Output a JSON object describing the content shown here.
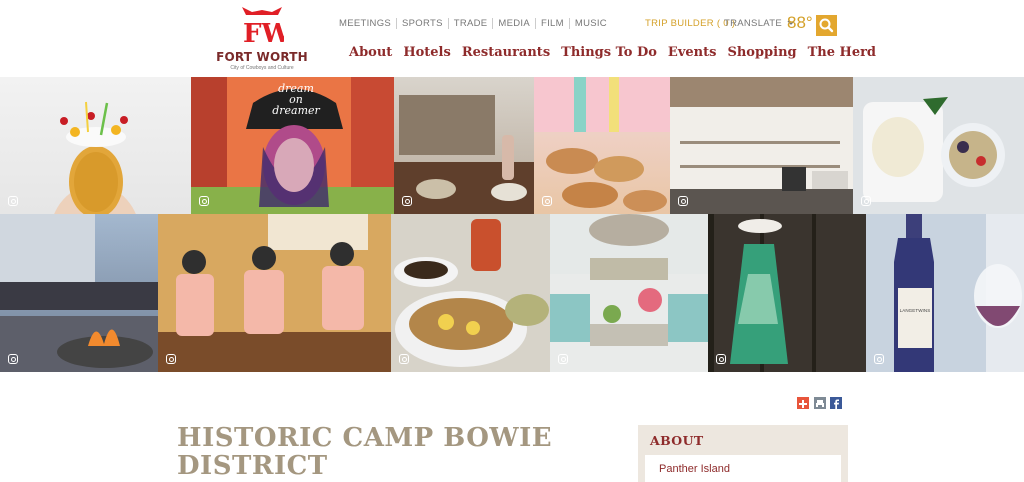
{
  "brand": {
    "name": "FORT WORTH",
    "tagline": "City of Cowboys and Culture",
    "red": "#e01f26",
    "maroon": "#8e2b2b",
    "gold": "#e3a72f"
  },
  "topnav": {
    "items": [
      "MEETINGS",
      "SPORTS",
      "TRADE",
      "MEDIA",
      "FILM",
      "MUSIC"
    ]
  },
  "utility": {
    "trip_builder": "TRIP BUILDER ( 0 )",
    "translate": "TRANSLATE",
    "temperature": "88°",
    "search_icon": "magnifier-icon"
  },
  "mainnav": {
    "items": [
      "About",
      "Hotels",
      "Restaurants",
      "Things To Do",
      "Events",
      "Shopping",
      "The Herd"
    ]
  },
  "gallery": {
    "mural_text": [
      "dream",
      "on",
      "dreamer"
    ],
    "wine_label": "LANGETWINS",
    "instagram_icon": "instagram-icon"
  },
  "share": {
    "icons": [
      "add-icon",
      "print-icon",
      "facebook-icon"
    ]
  },
  "content": {
    "title": "HISTORIC CAMP BOWIE DISTRICT"
  },
  "about": {
    "heading": "ABOUT",
    "items": [
      "Panther Island"
    ]
  }
}
